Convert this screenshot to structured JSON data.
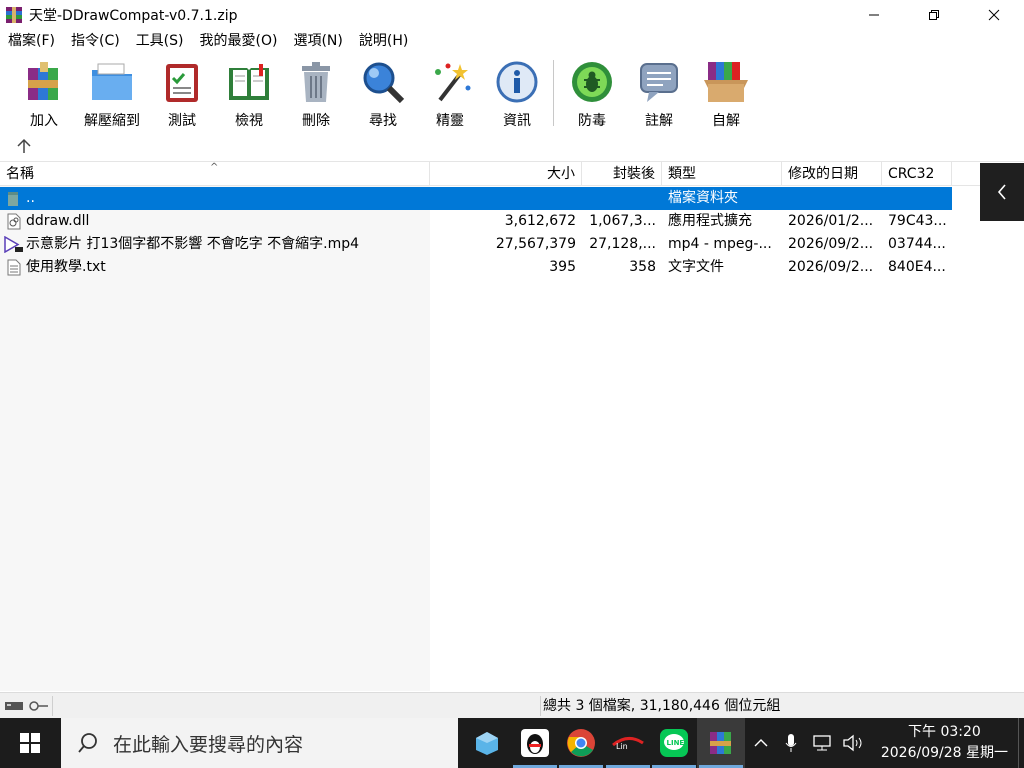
{
  "window": {
    "title": "天堂-DDrawCompat-v0.7.1.zip"
  },
  "menu": [
    "檔案(F)",
    "指令(C)",
    "工具(S)",
    "我的最愛(O)",
    "選項(N)",
    "說明(H)"
  ],
  "toolbar": [
    {
      "label": "加入",
      "icon": "add-archive-icon"
    },
    {
      "label": "解壓縮到",
      "icon": "extract-folder-icon"
    },
    {
      "label": "測試",
      "icon": "test-clipboard-icon"
    },
    {
      "label": "檢視",
      "icon": "view-book-icon"
    },
    {
      "label": "刪除",
      "icon": "trash-icon"
    },
    {
      "label": "尋找",
      "icon": "magnifier-icon"
    },
    {
      "label": "精靈",
      "icon": "wizard-wand-icon"
    },
    {
      "label": "資訊",
      "icon": "info-icon"
    },
    {
      "label": "防毒",
      "icon": "virus-scan-icon"
    },
    {
      "label": "註解",
      "icon": "comment-icon"
    },
    {
      "label": "自解",
      "icon": "sfx-box-icon"
    }
  ],
  "columns": [
    "名稱",
    "大小",
    "封裝後",
    "類型",
    "修改的日期",
    "CRC32"
  ],
  "rows": [
    {
      "name": "..",
      "size": "",
      "packed": "",
      "type": "檔案資料夾",
      "modified": "",
      "crc": "",
      "icon": "parent-folder-icon",
      "selected": true
    },
    {
      "name": "ddraw.dll",
      "size": "3,612,672",
      "packed": "1,067,3...",
      "type": "應用程式擴充",
      "modified": "2026/01/2...",
      "crc": "79C43...",
      "icon": "dll-file-icon",
      "selected": false
    },
    {
      "name": "示意影片 打13個字都不影響 不會吃字 不會縮字.mp4",
      "size": "27,567,379",
      "packed": "27,128,...",
      "type": "mp4 - mpeg-...",
      "modified": "2026/09/2...",
      "crc": "03744...",
      "icon": "video-file-icon",
      "selected": false
    },
    {
      "name": "使用教學.txt",
      "size": "395",
      "packed": "358",
      "type": "文字文件",
      "modified": "2026/09/2...",
      "crc": "840E4...",
      "icon": "text-file-icon",
      "selected": false
    }
  ],
  "status": {
    "summary": "總共 3 個檔案, 31,180,446 個位元組"
  },
  "taskbar": {
    "search_placeholder": "在此輸入要搜尋的內容",
    "time": "下午 03:20",
    "date": "2026/09/28 星期一"
  }
}
